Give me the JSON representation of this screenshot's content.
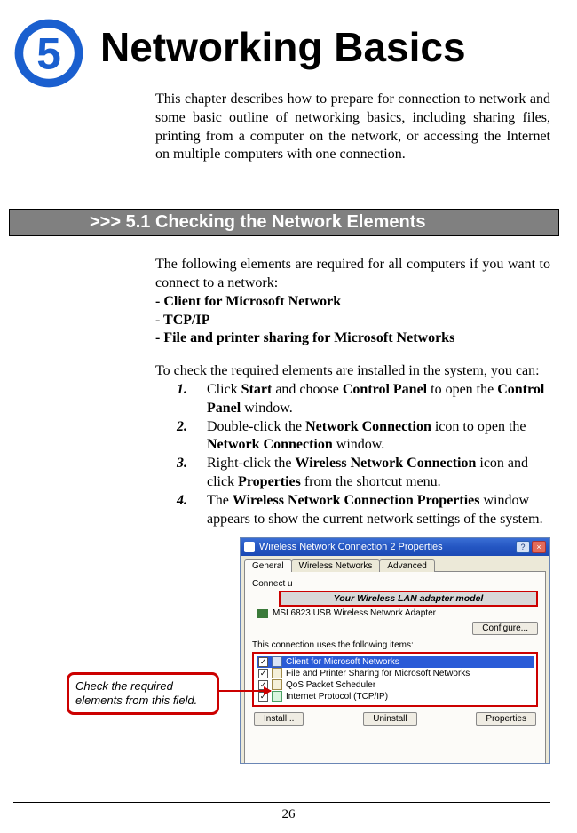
{
  "chapter_number": "5",
  "chapter_title": "Networking Basics",
  "intro_text": "This chapter describes how to prepare for connection to net­work and some basic outline of networking basics, including sharing files, printing from a computer on the network, or ac­cessing the Internet on multiple computers with one connection.",
  "section_bar": ">>> 5.1  Checking the Network Elements",
  "req_intro": "The following elements are required for all computers if you want to connect to a network:",
  "req1": "- Client for Microsoft Network",
  "req2": "- TCP/IP",
  "req3": "- File and printer sharing for Microsoft Networks",
  "check_intro": "To check the required elements are installed in the system, you can:",
  "steps": {
    "s1": {
      "num": "1.",
      "pre": "Click ",
      "b1": "Start",
      "mid1": " and choose ",
      "b2": "Control Panel",
      "mid2": " to open the ",
      "b3": "Control Panel",
      "post": " window."
    },
    "s2": {
      "num": "2.",
      "pre": "Double-click the ",
      "b1": "Network Connection",
      "mid1": " icon to open the ",
      "b2": "Network Connection",
      "post": " window."
    },
    "s3": {
      "num": "3.",
      "pre": "Right-click the ",
      "b1": "Wireless Network Connection",
      "mid1": " icon and click ",
      "b2": "Properties",
      "post": " from the shortcut menu."
    },
    "s4": {
      "num": "4.",
      "pre": "The ",
      "b1": "Wireless Network Connection Properties",
      "post": " window appears to show the current network settings of the system."
    }
  },
  "dialog": {
    "title": "Wireless Network Connection 2 Properties",
    "help_btn": "?",
    "close_btn": "×",
    "tabs": {
      "general": "General",
      "wireless": "Wireless Networks",
      "advanced": "Advanced"
    },
    "connect_label": "Connect u",
    "adapter_callout": "Your Wireless LAN adapter model",
    "adapter_name": "MSI 6823 USB Wireless Network Adapter",
    "configure_btn": "Configure...",
    "items_label": "This connection uses the following items:",
    "items": {
      "i1": "Client for Microsoft Networks",
      "i2": "File and Printer Sharing for Microsoft Networks",
      "i3": "QoS Packet Scheduler",
      "i4": "Internet Protocol (TCP/IP)"
    },
    "install_btn": "Install...",
    "uninstall_btn": "Uninstall",
    "properties_btn": "Properties"
  },
  "callout_check": "Check the required elements from this field.",
  "page_number": "26"
}
